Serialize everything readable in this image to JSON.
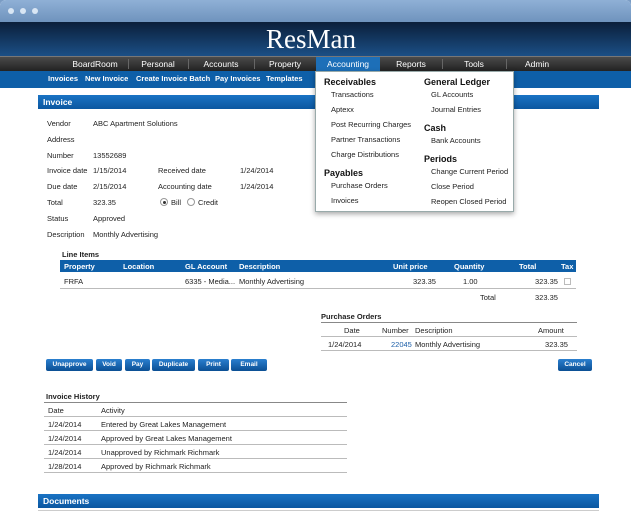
{
  "brand": {
    "logo": "ResMan"
  },
  "main_nav": [
    "BoardRoom",
    "Personal",
    "Accounts",
    "Property",
    "Accounting",
    "Reports",
    "Tools",
    "Admin"
  ],
  "sub_nav": [
    "Invoices",
    "New Invoice",
    "Create Invoice Batch",
    "Pay Invoices",
    "Templates"
  ],
  "invoice_panel": {
    "title": "Invoice"
  },
  "invoice": {
    "vendor_label": "Vendor",
    "vendor": "ABC Apartment Solutions",
    "address_label": "Address",
    "number_label": "Number",
    "number": "13552689",
    "invoice_date_label": "Invoice date",
    "invoice_date": "1/15/2014",
    "received_date_label": "Received date",
    "received_date": "1/24/2014",
    "due_date_label": "Due date",
    "due_date": "2/15/2014",
    "accounting_date_label": "Accounting date",
    "accounting_date": "1/24/2014",
    "total_label": "Total",
    "total": "323.35",
    "bill_label": "Bill",
    "credit_label": "Credit",
    "status_label": "Status",
    "status": "Approved",
    "description_label": "Description",
    "description": "Monthly Advertising"
  },
  "line_items": {
    "title": "Line Items",
    "headers": [
      "Property",
      "Location",
      "GL Account",
      "Description",
      "Unit price",
      "Quantity",
      "Total",
      "Tax"
    ],
    "row": {
      "property": "FRFA",
      "location": "",
      "gl_account": "6335 - Media...",
      "description": "Monthly Advertising",
      "unit_price": "323.35",
      "quantity": "1.00",
      "total": "323.35"
    },
    "total_label": "Total",
    "total": "323.35"
  },
  "purchase_orders": {
    "title": "Purchase Orders",
    "headers": [
      "Date",
      "Number",
      "Description",
      "Amount"
    ],
    "row": {
      "date": "1/24/2014",
      "number": "22045",
      "description": "Monthly Advertising",
      "amount": "323.35"
    }
  },
  "buttons": [
    "Unapprove",
    "Void",
    "Pay",
    "Duplicate",
    "Print",
    "Email"
  ],
  "cancel_button": "Cancel",
  "history": {
    "title": "Invoice History",
    "headers": [
      "Date",
      "Activity"
    ],
    "rows": [
      {
        "date": "1/24/2014",
        "activity": "Entered by Great Lakes Management"
      },
      {
        "date": "1/24/2014",
        "activity": "Approved by Great Lakes Management"
      },
      {
        "date": "1/24/2014",
        "activity": "Unapproved by Richmark Richmark"
      },
      {
        "date": "1/28/2014",
        "activity": "Approved by Richmark Richmark"
      }
    ]
  },
  "documents_panel": {
    "title": "Documents"
  },
  "accounting_menu": {
    "receivables": {
      "heading": "Receivables",
      "items": [
        "Transactions",
        "Aptexx",
        "Post Recurring Charges",
        "Partner Transactions",
        "Charge Distributions"
      ]
    },
    "payables": {
      "heading": "Payables",
      "items": [
        "Purchase Orders",
        "Invoices"
      ]
    },
    "general_ledger": {
      "heading": "General Ledger",
      "items": [
        "GL Accounts",
        "Journal Entries"
      ]
    },
    "cash": {
      "heading": "Cash",
      "items": [
        "Bank Accounts"
      ]
    },
    "periods": {
      "heading": "Periods",
      "items": [
        "Change Current Period",
        "Close Period",
        "Reopen Closed Period"
      ]
    }
  },
  "colors": {
    "nav_active": "#1d6fb8",
    "panel_bar": "#0b57a0",
    "sub_nav": "#0e5fa8"
  }
}
